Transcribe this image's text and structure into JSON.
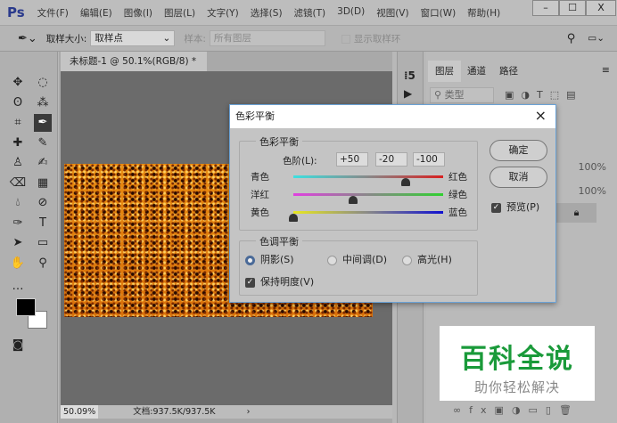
{
  "app": {
    "logo": "Ps"
  },
  "menu": [
    "文件(F)",
    "编辑(E)",
    "图像(I)",
    "图层(L)",
    "文字(Y)",
    "选择(S)",
    "滤镜(T)",
    "3D(D)",
    "视图(V)",
    "窗口(W)",
    "帮助(H)"
  ],
  "window": {
    "minimize": "–",
    "maximize": "☐",
    "close": "X"
  },
  "options": {
    "sample_size_label": "取样大小:",
    "sample_size_value": "取样点",
    "sample_label": "样本:",
    "sample_value": "所有图层",
    "show_ring_label": "显示取样环"
  },
  "document": {
    "tab_title": "未标题-1 @ 50.1%(RGB/8) *",
    "tab_close": "×",
    "zoom": "50.09%",
    "doc_info": "文档:937.5K/937.5K",
    "arrow": "›"
  },
  "layers_panel": {
    "tabs": [
      "图层",
      "通道",
      "路径"
    ],
    "filter": "类型",
    "opacity": "100%",
    "fill": "100%"
  },
  "dialog": {
    "title": "色彩平衡",
    "close": "×",
    "color_balance_group": "色彩平衡",
    "levels_label": "色阶(L):",
    "levels": [
      "+50",
      "-20",
      "-100"
    ],
    "sliders": [
      {
        "left": "青色",
        "right": "红色",
        "value": 50,
        "colors": [
          "#3de0e0",
          "#d82020"
        ]
      },
      {
        "left": "洋红",
        "right": "绿色",
        "value": -20,
        "colors": [
          "#e040e0",
          "#30d030"
        ]
      },
      {
        "left": "黄色",
        "right": "蓝色",
        "value": -100,
        "colors": [
          "#e8e820",
          "#1010d0"
        ]
      }
    ],
    "tone_group": "色调平衡",
    "tones": [
      "阴影(S)",
      "中间调(D)",
      "高光(H)"
    ],
    "selected_tone": 0,
    "preserve_luminosity": "保持明度(V)",
    "ok": "确定",
    "cancel": "取消",
    "preview": "预览(P)"
  },
  "watermark": {
    "title": "百科全说",
    "subtitle": "助你轻松解决",
    "color": "#1a9a3a"
  }
}
